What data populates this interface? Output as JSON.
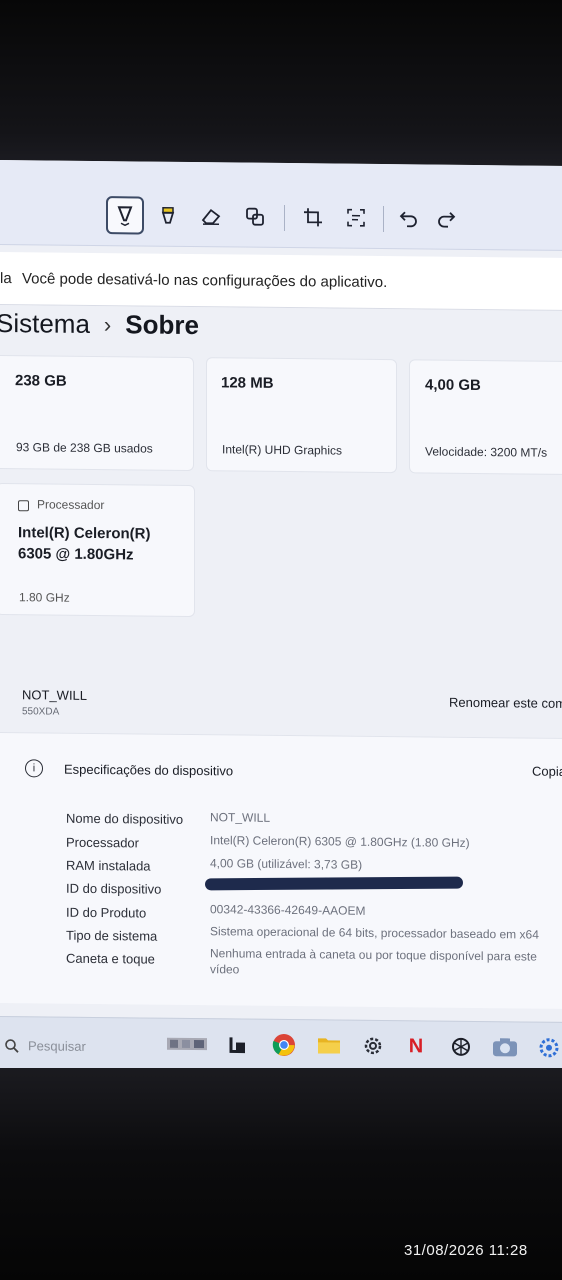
{
  "notice": {
    "prefix": "la",
    "text": "Você pode desativá-lo nas configurações do aplicativo."
  },
  "breadcrumb": {
    "parent": "Sistema",
    "separator": "›",
    "current": "Sobre"
  },
  "cards": [
    {
      "value": "238 GB",
      "detail": "93 GB de 238 GB usados"
    },
    {
      "value": "128 MB",
      "detail": "Intel(R) UHD Graphics"
    },
    {
      "value": "4,00 GB",
      "detail": "Velocidade: 3200 MT/s"
    }
  ],
  "processor_card": {
    "label": "Processador",
    "value_line1": "Intel(R) Celeron(R)",
    "value_line2": "6305 @ 1.80GHz",
    "detail": "1.80 GHz"
  },
  "device": {
    "name": "NOT_WILL",
    "model": "550XDA",
    "rename_label": "Renomear este com"
  },
  "specs": {
    "title": "Especificações do dispositivo",
    "copy_label": "Copia",
    "rows": [
      {
        "label": "Nome do dispositivo",
        "value": "NOT_WILL"
      },
      {
        "label": "Processador",
        "value": "Intel(R) Celeron(R) 6305 @ 1.80GHz (1.80 GHz)"
      },
      {
        "label": "RAM instalada",
        "value": "4,00 GB (utilizável: 3,73 GB)"
      },
      {
        "label": "ID do dispositivo",
        "value": ""
      },
      {
        "label": "ID do Produto",
        "value": "00342-43366-42649-AAOEM"
      },
      {
        "label": "Tipo de sistema",
        "value": "Sistema operacional de 64 bits, processador baseado em x64"
      },
      {
        "label": "Caneta e toque",
        "value": "Nenhuma entrada à caneta ou por toque disponível para este",
        "value2": "vídeo"
      }
    ]
  },
  "taskbar": {
    "search_placeholder": "Pesquisar"
  },
  "timestamp": "31/08/2026 11:28",
  "colors": {
    "accent": "#3d4b66",
    "screen_bg": "#eef0f6",
    "redaction": "#1e2a4c"
  }
}
